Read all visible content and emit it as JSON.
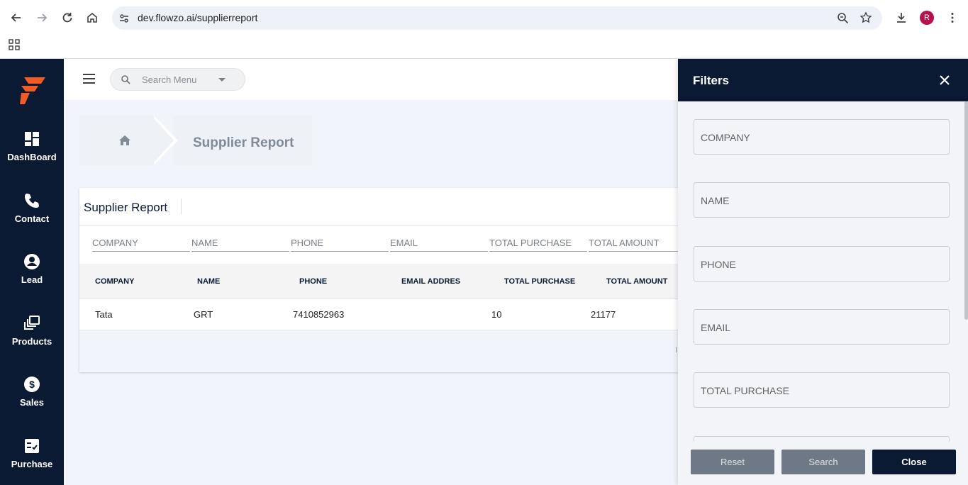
{
  "browser": {
    "url": "dev.flowzo.ai/supplierreport",
    "profile_initial": "R"
  },
  "sidebar": {
    "items": [
      {
        "label": "DashBoard",
        "icon": "dashboard-icon"
      },
      {
        "label": "Contact",
        "icon": "phone-icon"
      },
      {
        "label": "Lead",
        "icon": "user-circle-icon"
      },
      {
        "label": "Products",
        "icon": "products-icon"
      },
      {
        "label": "Sales",
        "icon": "dollar-icon"
      },
      {
        "label": "Purchase",
        "icon": "purchase-icon"
      }
    ]
  },
  "header": {
    "search_placeholder": "Search Menu"
  },
  "breadcrumb": {
    "current": "Supplier Report"
  },
  "report": {
    "title": "Supplier Report",
    "filters": [
      "COMPANY",
      "NAME",
      "PHONE",
      "EMAIL",
      "TOTAL PURCHASE",
      "TOTAL AMOUNT"
    ],
    "columns": [
      "COMPANY",
      "NAME",
      "PHONE",
      "EMAIL ADDRES",
      "TOTAL PURCHASE",
      "TOTAL AMOUNT"
    ],
    "rows": [
      {
        "company": "Tata",
        "name": "GRT",
        "phone": "7410852963",
        "email": "",
        "total_purchase": "10",
        "total_amount": "21177"
      }
    ],
    "footer_fragment": "I"
  },
  "drawer": {
    "title": "Filters",
    "fields": [
      "COMPANY",
      "NAME",
      "PHONE",
      "EMAIL",
      "TOTAL PURCHASE"
    ],
    "buttons": {
      "reset": "Reset",
      "search": "Search",
      "close": "Close"
    }
  },
  "colors": {
    "navy": "#0b1a33",
    "brand_orange": "#f15a24",
    "content_bg": "#f1f5fb"
  }
}
